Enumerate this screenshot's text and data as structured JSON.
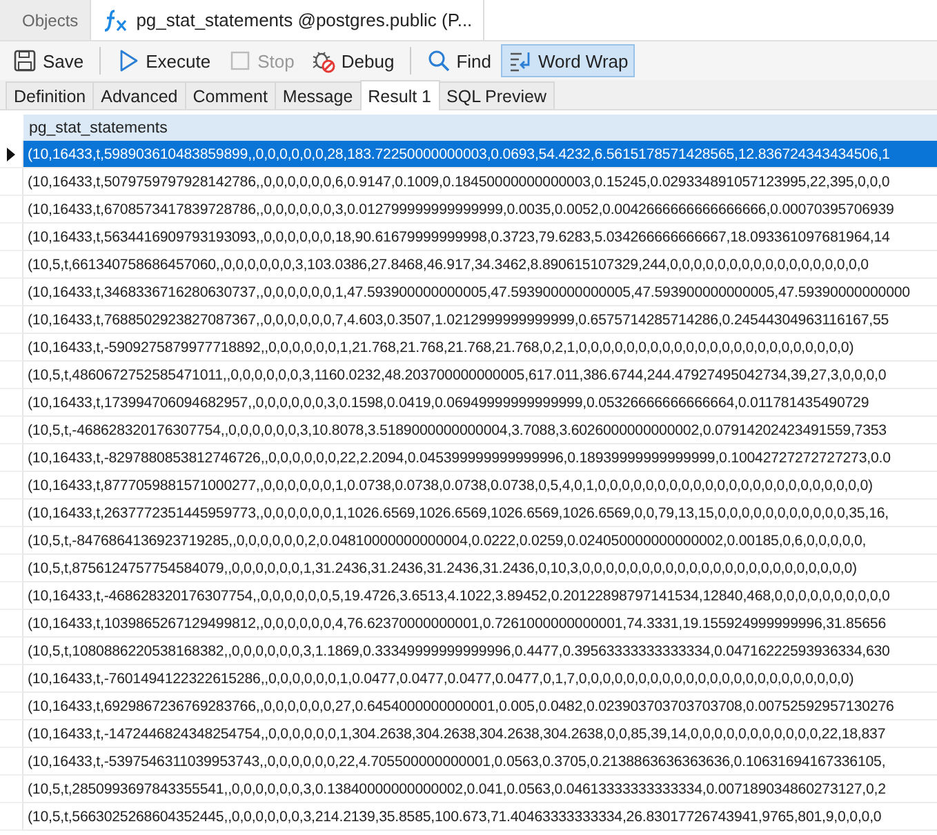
{
  "tabs": [
    {
      "label": "Objects",
      "selected": false,
      "kind": "plain"
    },
    {
      "label": "pg_stat_statements @postgres.public (P...",
      "selected": true,
      "kind": "function"
    }
  ],
  "toolbar": [
    [
      {
        "label": "Save",
        "kind": "save",
        "disabled": false,
        "on": false
      }
    ],
    [
      {
        "label": "Execute",
        "kind": "execute",
        "disabled": false,
        "on": false
      },
      {
        "label": "Stop",
        "kind": "stop",
        "disabled": true,
        "on": false
      },
      {
        "label": "Debug",
        "kind": "debug",
        "disabled": false,
        "on": false
      }
    ],
    [
      {
        "label": "Find",
        "kind": "find",
        "disabled": false,
        "on": false
      },
      {
        "label": "Word Wrap",
        "kind": "wrap",
        "disabled": false,
        "on": true
      }
    ]
  ],
  "subtabs": [
    {
      "label": "Definition",
      "selected": false
    },
    {
      "label": "Advanced",
      "selected": false
    },
    {
      "label": "Comment",
      "selected": false
    },
    {
      "label": "Message",
      "selected": false
    },
    {
      "label": "Result 1",
      "selected": true
    },
    {
      "label": "SQL Preview",
      "selected": false
    }
  ],
  "grid": {
    "columns": [
      "pg_stat_statements"
    ],
    "rows": [
      {
        "value": "(10,16433,t,598903610483859899,,0,0,0,0,0,0,28,183.72250000000003,0.0693,54.4232,6.5615178571428565,12.836724343434506,1",
        "selected": true
      },
      {
        "value": "(10,16433,t,5079759797928142786,,0,0,0,0,0,0,6,0.9147,0.1009,0.18450000000000003,0.15245,0.029334891057123995,22,395,0,0,0",
        "selected": false
      },
      {
        "value": "(10,16433,t,6708573417839728786,,0,0,0,0,0,0,3,0.012799999999999999,0.0035,0.0052,0.0042666666666666666,0.00070395706939",
        "selected": false
      },
      {
        "value": "(10,16433,t,5634416909793193093,,0,0,0,0,0,0,18,90.61679999999998,0.3723,79.6283,5.034266666666667,18.093361097681964,14",
        "selected": false
      },
      {
        "value": "(10,5,t,661340758686457060,,0,0,0,0,0,0,3,103.0386,27.8468,46.917,34.3462,8.890615107329,244,0,0,0,0,0,0,0,0,0,0,0,0,0,0,0,0,0",
        "selected": false
      },
      {
        "value": "(10,16433,t,3468336716280630737,,0,0,0,0,0,0,1,47.593900000000005,47.593900000000005,47.593900000000005,47.59390000000000",
        "selected": false
      },
      {
        "value": "(10,16433,t,7688502923827087367,,0,0,0,0,0,0,7,4.603,0.3507,1.0212999999999999,0.6575714285714286,0.24544304963116167,55",
        "selected": false
      },
      {
        "value": "(10,16433,t,-5909275879977718892,,0,0,0,0,0,0,1,21.768,21.768,21.768,21.768,0,2,1,0,0,0,0,0,0,0,0,0,0,0,0,0,0,0,0,0,0,0,0,0,0,0)",
        "selected": false
      },
      {
        "value": "(10,5,t,4860672752585471011,,0,0,0,0,0,0,3,1160.0232,48.203700000000005,617.011,386.6744,244.47927495042734,39,27,3,0,0,0,0",
        "selected": false
      },
      {
        "value": "(10,16433,t,173994706094682957,,0,0,0,0,0,0,3,0.1598,0.0419,0.06949999999999999,0.05326666666666664,0.011781435490729",
        "selected": false
      },
      {
        "value": "(10,5,t,-468628320176307754,,0,0,0,0,0,0,3,10.8078,3.5189000000000004,3.7088,3.6026000000000002,0.07914202423491559,7353",
        "selected": false
      },
      {
        "value": "(10,16433,t,-8297880853812746726,,0,0,0,0,0,0,22,2.2094,0.045399999999999996,0.18939999999999999,0.10042727272727273,0.0",
        "selected": false
      },
      {
        "value": "(10,16433,t,8777059881571000277,,0,0,0,0,0,0,1,0.0738,0.0738,0.0738,0.0738,0,5,4,0,1,0,0,0,0,0,0,0,0,0,0,0,0,0,0,0,0,0,0,0,0,0,0,0)",
        "selected": false
      },
      {
        "value": "(10,16433,t,2637772351445959773,,0,0,0,0,0,0,1,1026.6569,1026.6569,1026.6569,1026.6569,0,0,79,13,15,0,0,0,0,0,0,0,0,0,0,0,35,16,",
        "selected": false
      },
      {
        "value": "(10,5,t,-8476864136923719285,,0,0,0,0,0,0,2,0.04810000000000004,0.0222,0.0259,0.024050000000000002,0.00185,0,6,0,0,0,0,0,",
        "selected": false
      },
      {
        "value": "(10,5,t,8756124757754584079,,0,0,0,0,0,0,1,31.2436,31.2436,31.2436,31.2436,0,10,3,0,0,0,0,0,0,0,0,0,0,0,0,0,0,0,0,0,0,0,0,0,0,0)",
        "selected": false
      },
      {
        "value": "(10,16433,t,-468628320176307754,,0,0,0,0,0,0,5,19.4726,3.6513,4.1022,3.89452,0.20122898797141534,12840,468,0,0,0,0,0,0,0,0,0,0",
        "selected": false
      },
      {
        "value": "(10,16433,t,1039865267129499812,,0,0,0,0,0,0,4,76.62370000000001,0.7261000000000001,74.3331,19.155924999999996,31.85656",
        "selected": false
      },
      {
        "value": "(10,5,t,1080886220538168382,,0,0,0,0,0,0,3,1.1869,0.33349999999999996,0.4477,0.39563333333333334,0.04716222593936334,630",
        "selected": false
      },
      {
        "value": "(10,16433,t,-7601494122322615286,,0,0,0,0,0,0,1,0.0477,0.0477,0.0477,0.0477,0,1,7,0,0,0,0,0,0,0,0,0,0,0,0,0,0,0,0,0,0,0,0,0,0,0)",
        "selected": false
      },
      {
        "value": "(10,16433,t,6929867236769283766,,0,0,0,0,0,0,27,0.6454000000000001,0.005,0.0482,0.023903703703703708,0.00752592957130276",
        "selected": false
      },
      {
        "value": "(10,16433,t,-1472446824348254754,,0,0,0,0,0,0,1,304.2638,304.2638,304.2638,304.2638,0,0,85,39,14,0,0,0,0,0,0,0,0,0,0,0,22,18,837",
        "selected": false
      },
      {
        "value": "(10,16433,t,-5397546311039953743,,0,0,0,0,0,0,22,4.705500000000001,0.0563,0.3705,0.2138863636363636,0.10631694167336105,",
        "selected": false
      },
      {
        "value": "(10,5,t,2850993697843355541,,0,0,0,0,0,0,3,0.13840000000000002,0.041,0.0563,0.04613333333333334,0.007189034860273127,0,2",
        "selected": false
      },
      {
        "value": "(10,5,t,5663025268604352445,,0,0,0,0,0,0,3,214.2139,35.8585,100.673,71.40463333333334,26.83017726743941,9765,801,9,0,0,0,0",
        "selected": false
      }
    ]
  }
}
